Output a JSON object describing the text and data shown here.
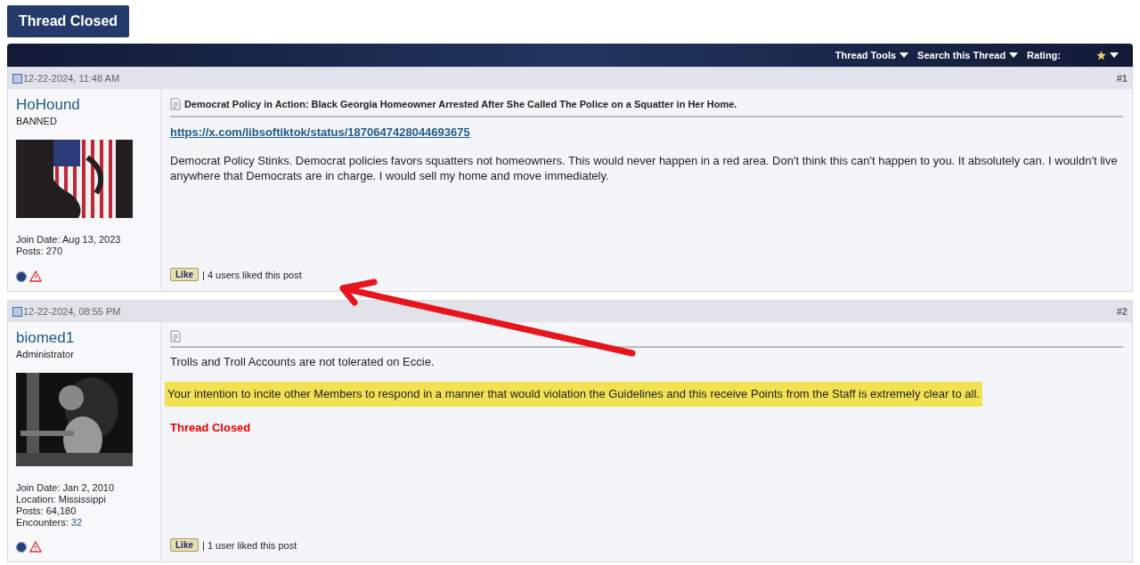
{
  "top_button": "Thread Closed",
  "toolbar": {
    "items": [
      {
        "label": "Thread Tools"
      },
      {
        "label": "Search this Thread"
      }
    ],
    "rating_label": "Rating:"
  },
  "posts": [
    {
      "date": "12-22-2024, 11:48 AM",
      "number": "#1",
      "username": "HoHound",
      "role": "BANNED",
      "info": [
        {
          "label": "Join Date:",
          "value": "Aug 13, 2023",
          "link": false
        },
        {
          "label": "Posts:",
          "value": "270",
          "link": false
        }
      ],
      "title": "Democrat Policy in Action: Black Georgia Homeowner Arrested After She Called The Police on a Squatter in Her Home.",
      "body": [
        {
          "kind": "link",
          "text": "https://x.com/libsoftiktok/status/1870647428044693675"
        },
        {
          "kind": "plain",
          "text": "Democrat Policy Stinks. Democrat policies favors squatters not homeowners. This would never happen in a red area. Don't think this can't happen to you. It absolutely can. I wouldn't live anywhere that Democrats are in charge. I would sell my home and move immediately."
        }
      ],
      "like_button": "Like",
      "likes": "| 4 users liked this post",
      "avatar": {
        "kind": "picture"
      }
    },
    {
      "date": "12-22-2024, 08:55 PM",
      "number": "#2",
      "username": "biomed1",
      "role": "Administrator",
      "info": [
        {
          "label": "Join Date:",
          "value": "Jan 2, 2010",
          "link": false
        },
        {
          "label": "Location:",
          "value": "Mississippi",
          "link": false
        },
        {
          "label": "Posts:",
          "value": "64,180",
          "link": false
        },
        {
          "label": "Encounters:",
          "value": "32",
          "link": true
        }
      ],
      "body": [
        {
          "kind": "plain",
          "text": "Trolls and Troll Accounts are not tolerated on Eccie."
        },
        {
          "kind": "highlight",
          "text": "Your intention to incite other Members to respond in a manner that would violation the Guidelines and this receive Points from the Staff is extremely clear to all."
        },
        {
          "kind": "closed",
          "text": "Thread Closed"
        }
      ],
      "like_button": "Like",
      "likes": "| 1 user liked this post",
      "avatar": {
        "kind": "picture"
      }
    }
  ]
}
